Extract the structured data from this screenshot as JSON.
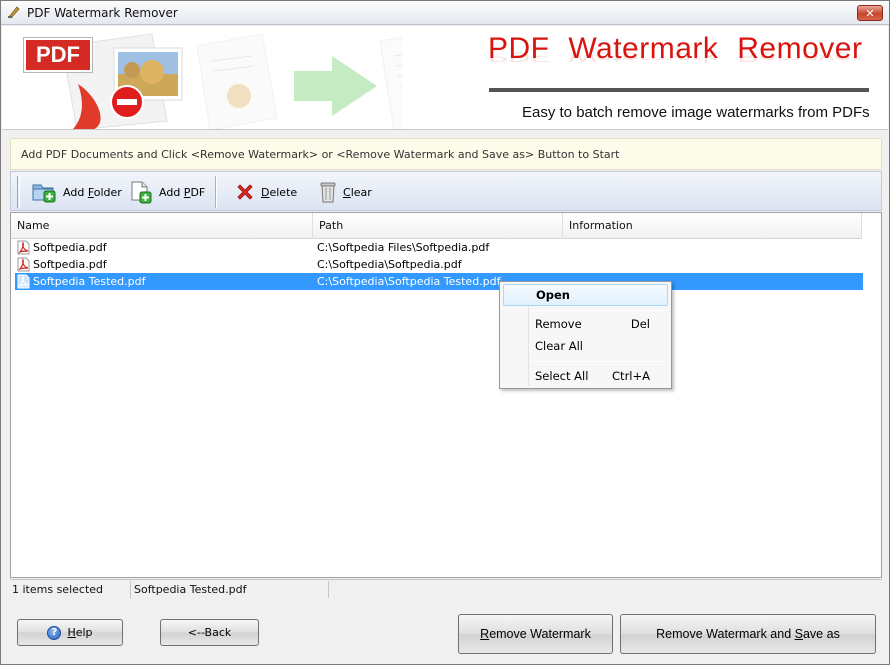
{
  "window": {
    "title": "PDF Watermark Remover",
    "close_glyph": "✕"
  },
  "banner": {
    "logo_text": "PDF",
    "title": "PDF Watermark Remover",
    "subtitle": "Easy to batch remove image watermarks from PDFs"
  },
  "instruction": "Add PDF Documents and Click <Remove Watermark> or <Remove Watermark and Save as> Button to Start",
  "toolbar": {
    "add_folder": {
      "mnemonic": "A",
      "rest": "dd ",
      "underlined": "F",
      "tail": "older"
    },
    "add_pdf": {
      "pre": "Add ",
      "underlined": "P",
      "tail": "DF"
    },
    "delete": {
      "underlined": "D",
      "tail": "elete"
    },
    "clear": {
      "underlined": "C",
      "tail": "lear"
    }
  },
  "list": {
    "columns": [
      "Name",
      "Path",
      "Information"
    ],
    "rows": [
      {
        "name": "Softpedia.pdf",
        "path": "C:\\Softpedia Files\\Softpedia.pdf",
        "info": ""
      },
      {
        "name": "Softpedia.pdf",
        "path": "C:\\Softpedia\\Softpedia.pdf",
        "info": ""
      },
      {
        "name": "Softpedia Tested.pdf",
        "path": "C:\\Softpedia\\Softpedia Tested.pdf",
        "info": ""
      }
    ],
    "selected_row": 3
  },
  "context_menu": {
    "items": [
      {
        "label": "Open",
        "shortcut": ""
      },
      {
        "label": "Remove",
        "shortcut": "Del"
      },
      {
        "label": "Clear All",
        "shortcut": ""
      },
      {
        "label": "Select All",
        "shortcut": "Ctrl+A"
      }
    ]
  },
  "status": {
    "selected_count": "1 items selected",
    "current_file": "Softpedia Tested.pdf"
  },
  "buttons": {
    "help_pre": "",
    "help_underlined": "H",
    "help_tail": "elp",
    "back": "<--Back",
    "remove_underlined": "R",
    "remove_tail": "emove Watermark",
    "remove_save_pre": "Remove Watermark and ",
    "remove_save_underlined": "S",
    "remove_save_tail": "ave as"
  },
  "colors": {
    "brand_red": "#d9140f",
    "selection_blue": "#3399ff",
    "toolbar_bg": "#dce4f2",
    "instruction_bg": "#fdfbe9"
  },
  "icons": [
    "app-icon",
    "close-icon",
    "pdf-logo-icon",
    "add-folder-icon",
    "add-pdf-icon",
    "delete-icon",
    "clear-icon",
    "pdf-file-icon",
    "help-icon"
  ]
}
